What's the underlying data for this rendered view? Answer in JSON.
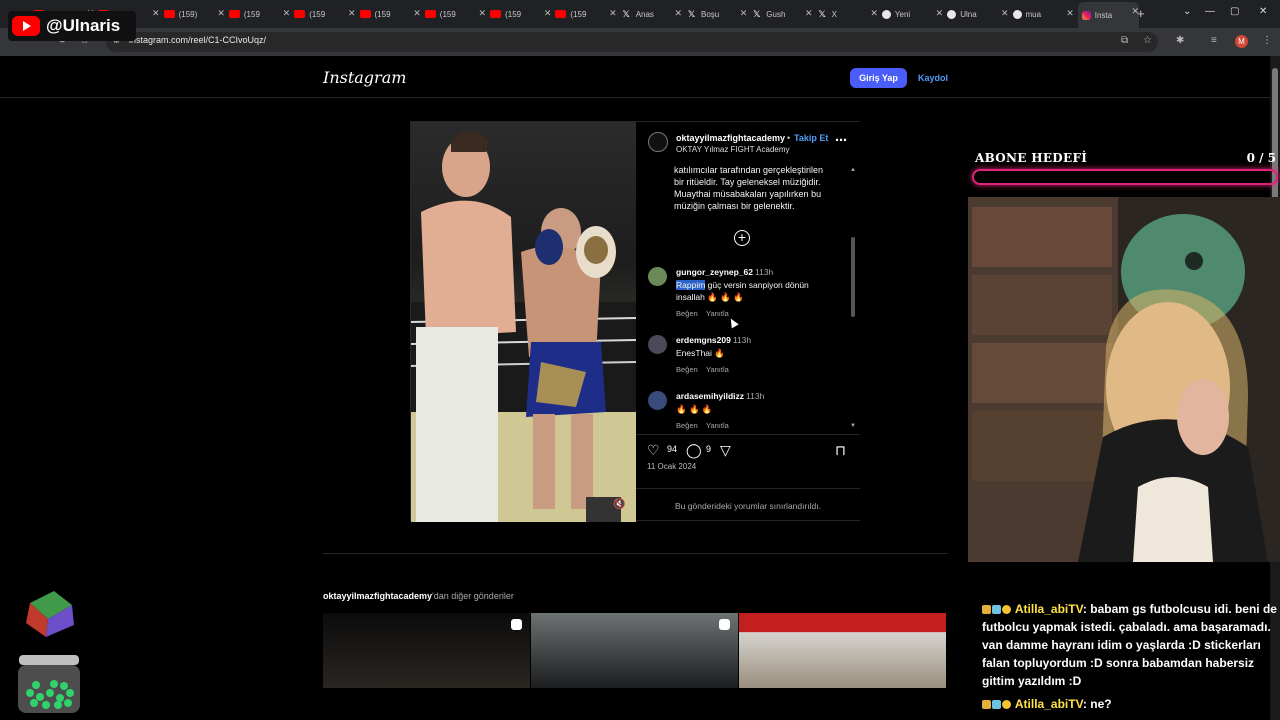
{
  "browser": {
    "tabs": [
      {
        "label": "(159",
        "icon": "youtube-icon"
      },
      {
        "label": "(159",
        "icon": "youtube-icon"
      },
      {
        "label": "(159)",
        "icon": "youtube-icon"
      },
      {
        "label": "(159",
        "icon": "youtube-icon"
      },
      {
        "label": "(159",
        "icon": "youtube-icon"
      },
      {
        "label": "(159",
        "icon": "youtube-icon"
      },
      {
        "label": "(159",
        "icon": "youtube-icon"
      },
      {
        "label": "(159",
        "icon": "youtube-icon"
      },
      {
        "label": "(159",
        "icon": "youtube-icon"
      },
      {
        "label": "Anas",
        "icon": "x-icon"
      },
      {
        "label": "Boşu",
        "icon": "x-icon"
      },
      {
        "label": "Gush",
        "icon": "x-icon"
      },
      {
        "label": "X",
        "icon": "x-icon"
      },
      {
        "label": "Yeni",
        "icon": "globe-icon"
      },
      {
        "label": "Ulna",
        "icon": "globe-icon"
      },
      {
        "label": "mua",
        "icon": "google-icon"
      },
      {
        "label": "Insta",
        "icon": "instagram-icon"
      }
    ],
    "new_tab": "+",
    "url": "instagram.com/reel/C1-CCIvoUqz/",
    "profile_initial": "M"
  },
  "stream_overlay": {
    "channel_handle": "@Ulnaris",
    "goal_title": "ABONE HEDEFİ",
    "goal_count": "0 / 5",
    "goal_progress": 0,
    "chat": [
      {
        "user": "Atilla_abiTV",
        "text": "babam gs futbolcusu idi. beni de futbolcu yapmak istedi. çabaladı. ama başaramadı. van damme hayranı idim o yaşlarda :D stickerları falan topluyordum :D sonra babamdan habersiz gittim yazıldım :D"
      },
      {
        "user": "Atilla_abiTV",
        "text": "ne?"
      }
    ]
  },
  "instagram": {
    "logo": "Instagram",
    "login_button": "Giriş Yap",
    "signup_link": "Kaydol",
    "post": {
      "username": "oktayyilmazfightacademy",
      "dot": "•",
      "follow": "Takip Et",
      "subtitle": "OKTAY Yılmaz FIGHT Academy",
      "caption": "katılımcılar tarafından gerçekleştirilen bir ritüeldir. Tay geleneksel müziğidir. Muaythai müsabakaları yapılırken bu müziğin çalması bir gelenektir.",
      "comments": [
        {
          "user": "gungor_zeynep_62",
          "time": "113h",
          "highlight": "Rappim",
          "text": " güç versin sanpiyon dönün insallah",
          "emoji": " 🔥 🔥 🔥",
          "like": "Beğen",
          "reply": "Yanıtla"
        },
        {
          "user": "erdemgns209",
          "time": "113h",
          "highlight": "",
          "text": "EnesThai",
          "emoji": " 🔥",
          "like": "Beğen",
          "reply": "Yanıtla"
        },
        {
          "user": "ardasemihyildizz",
          "time": "113h",
          "highlight": "",
          "text": "",
          "emoji": "🔥 🔥 🔥",
          "like": "Beğen",
          "reply": "Yanıtla"
        }
      ],
      "likes": "94",
      "comment_count": "9",
      "date": "11 Ocak 2024",
      "restricted_notice": "Bu gönderideki yorumlar sınırlandırıldı."
    },
    "more_posts": {
      "account": "oktayyilmazfightacademy",
      "suffix": "'dan diğer gönderiler"
    }
  }
}
